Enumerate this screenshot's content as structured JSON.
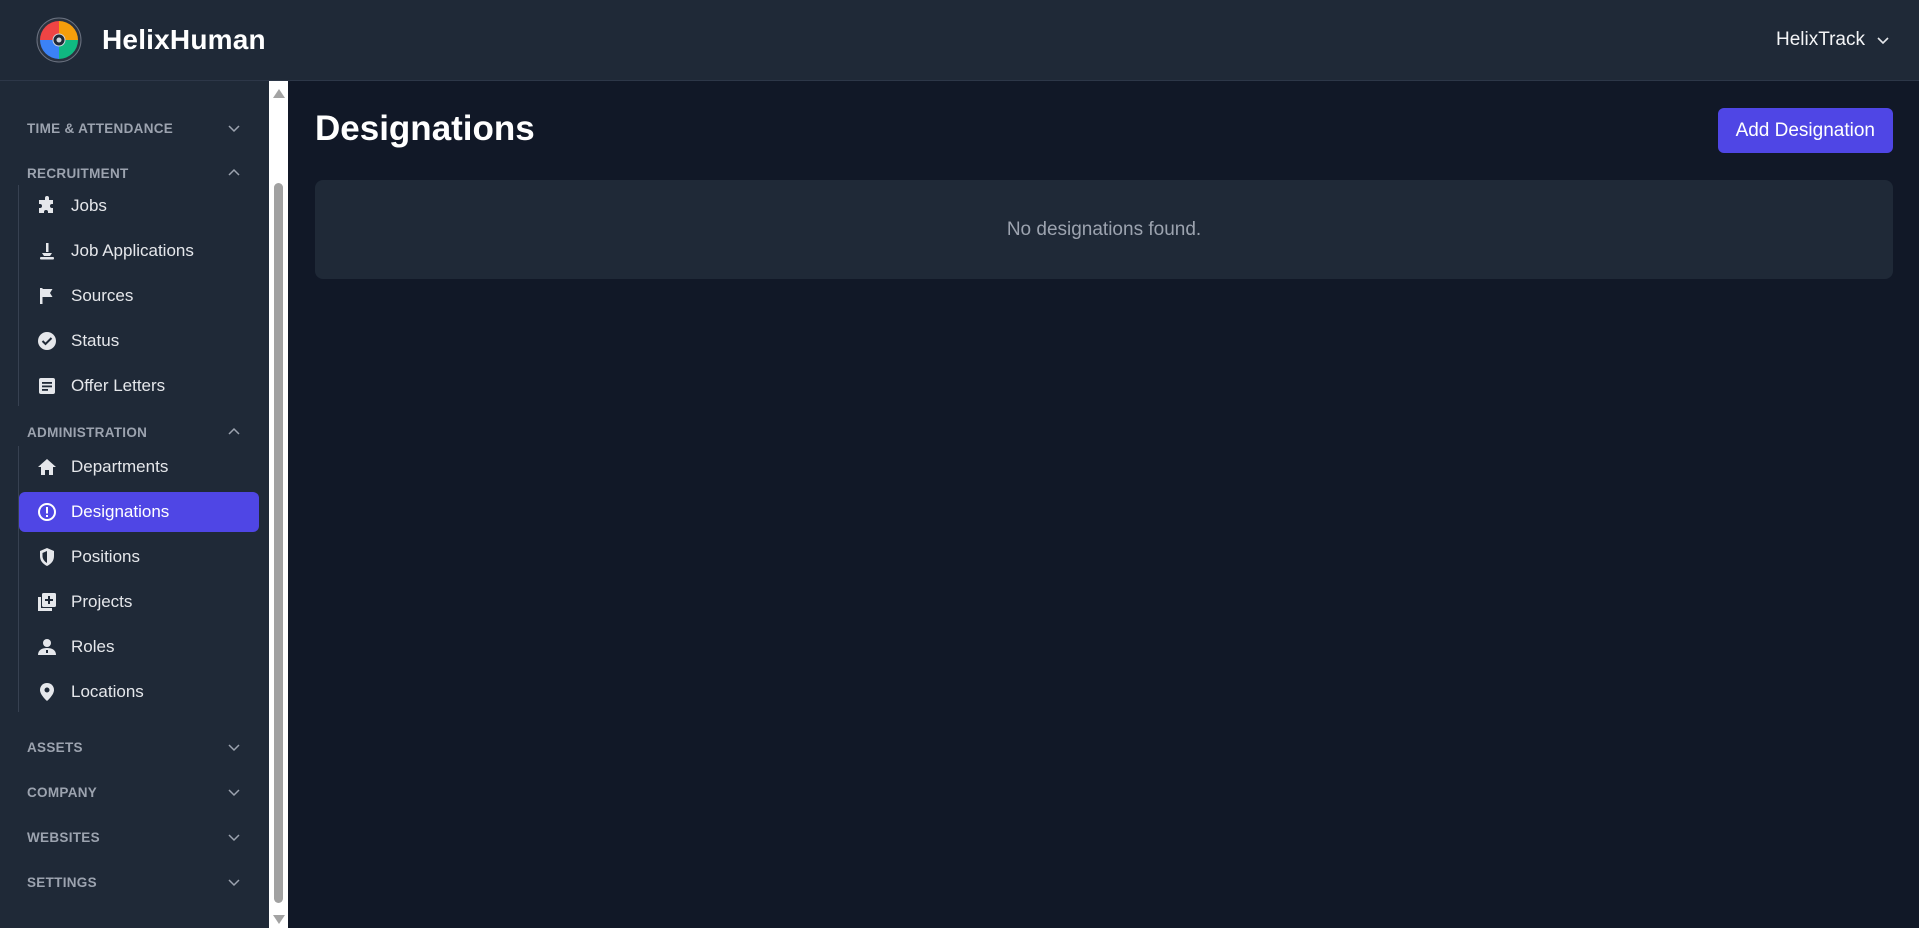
{
  "app": {
    "brand_name": "HelixHuman",
    "org_switcher": "HelixTrack"
  },
  "sidebar": {
    "sections": [
      {
        "key": "time",
        "label": "TIME & ATTENDANCE",
        "expanded": false
      },
      {
        "key": "recruitment",
        "label": "RECRUITMENT",
        "expanded": true,
        "items": [
          {
            "label": "Jobs",
            "icon": "puzzle-icon"
          },
          {
            "label": "Job Applications",
            "icon": "person-icon"
          },
          {
            "label": "Sources",
            "icon": "flag-icon"
          },
          {
            "label": "Status",
            "icon": "check-circle-icon"
          },
          {
            "label": "Offer Letters",
            "icon": "document-icon"
          }
        ]
      },
      {
        "key": "administration",
        "label": "ADMINISTRATION",
        "expanded": true,
        "items": [
          {
            "label": "Departments",
            "icon": "home-icon"
          },
          {
            "label": "Designations",
            "icon": "alert-circle-icon",
            "active": true
          },
          {
            "label": "Positions",
            "icon": "shield-icon"
          },
          {
            "label": "Projects",
            "icon": "add-box-icon"
          },
          {
            "label": "Roles",
            "icon": "user-badge-icon"
          },
          {
            "label": "Locations",
            "icon": "location-pin-icon"
          }
        ]
      },
      {
        "key": "assets",
        "label": "ASSETS",
        "expanded": false
      },
      {
        "key": "company",
        "label": "COMPANY",
        "expanded": false
      },
      {
        "key": "websites",
        "label": "WEBSITES",
        "expanded": false
      },
      {
        "key": "settings",
        "label": "SETTINGS",
        "expanded": false
      }
    ]
  },
  "main": {
    "title": "Designations",
    "add_button": "Add Designation",
    "empty_message": "No designations found."
  },
  "colors": {
    "accent": "#4f46e5",
    "background": "#111827",
    "panel": "#1f2937"
  }
}
